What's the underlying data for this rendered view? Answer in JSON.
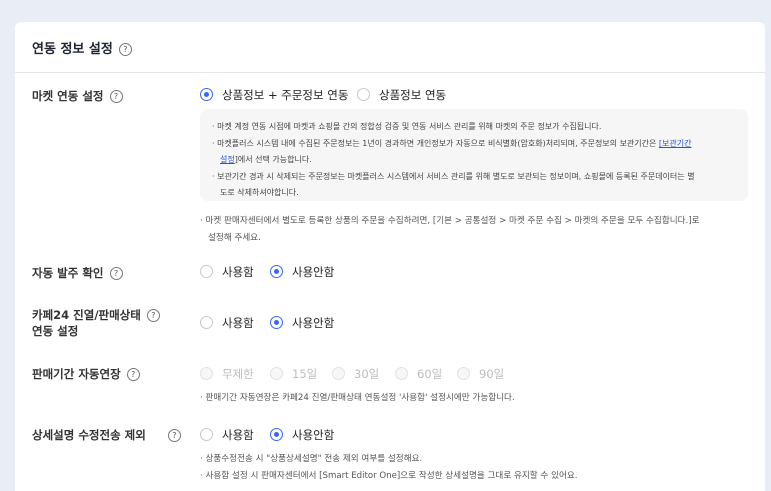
{
  "section": {
    "title": "연동 정보 설정"
  },
  "market_link": {
    "label": "마켓 연동 설정",
    "options": [
      "상품정보 + 주문정보 연동",
      "상품정보 연동"
    ],
    "selected": 0,
    "info": {
      "line1": "· 마켓 계정 연동 시점에 마켓과 쇼핑몰 간의 정합성 검증 및 연동 서비스 관리를 위해 마켓의 주문 정보가 수집됩니다.",
      "line2_pre": "· 마켓플러스 시스템 내에 수집된 주문정보는 1년이 경과하면 개인정보가 자동으로 비식별화(암호화)처리되며, 주문정보의 보관기간은 ",
      "line2_link": "[보관기간",
      "line3_link": "설정",
      "line3_post": "]에서 선택 가능합니다.",
      "line4": "· 보관기간 경과 시 삭제되는 주문정보는 마켓플러스 시스템에서 서비스 관리를 위해 별도로 보관되는 정보이며, 쇼핑몰에 등록된 주문데이터는 별",
      "line5": "도로 삭제하셔야합니다."
    },
    "note1": "· 마켓 판매자센터에서 별도로 등록한 상품의 주문을 수집하려면, [기본 > 공통설정 > 마켓 주문 수집 > 마켓의 주문을 모두 수집합니다.]로",
    "note2": "설정해 주세요."
  },
  "auto_order": {
    "label": "자동 발주 확인",
    "options": [
      "사용함",
      "사용안함"
    ],
    "selected": 1
  },
  "cafe24_display": {
    "label1": "카페24 진열/판매상태",
    "label2": "연동 설정",
    "options": [
      "사용함",
      "사용안함"
    ],
    "selected": 1
  },
  "sale_period": {
    "label": "판매기간 자동연장",
    "options": [
      "무제한",
      "15일",
      "30일",
      "60일",
      "90일"
    ],
    "disabled": true,
    "note": "· 판매기간 자동연장은 카페24 진열/판매상태 연동설정 '사용함' 설정시에만 가능합니다."
  },
  "detail_exclude": {
    "label": "상세설명 수정전송 제외",
    "options": [
      "사용함",
      "사용안함"
    ],
    "selected": 1,
    "note1": "· 상품수정전송 시 \"상품상세설명\" 전송 제외 여부를 설정해요.",
    "note2": "· 사용함 설정 시 판매자센터에서 [Smart Editor One]으로 작성한 상세설명을 그대로 유지할 수 있어요."
  },
  "icons": {
    "help": "question-circle-icon",
    "radio": "radio-icon"
  },
  "colors": {
    "accent": "#3a66f5",
    "background": "#e9edf6",
    "info_box": "#f6f6f6",
    "link": "#2456d8"
  }
}
